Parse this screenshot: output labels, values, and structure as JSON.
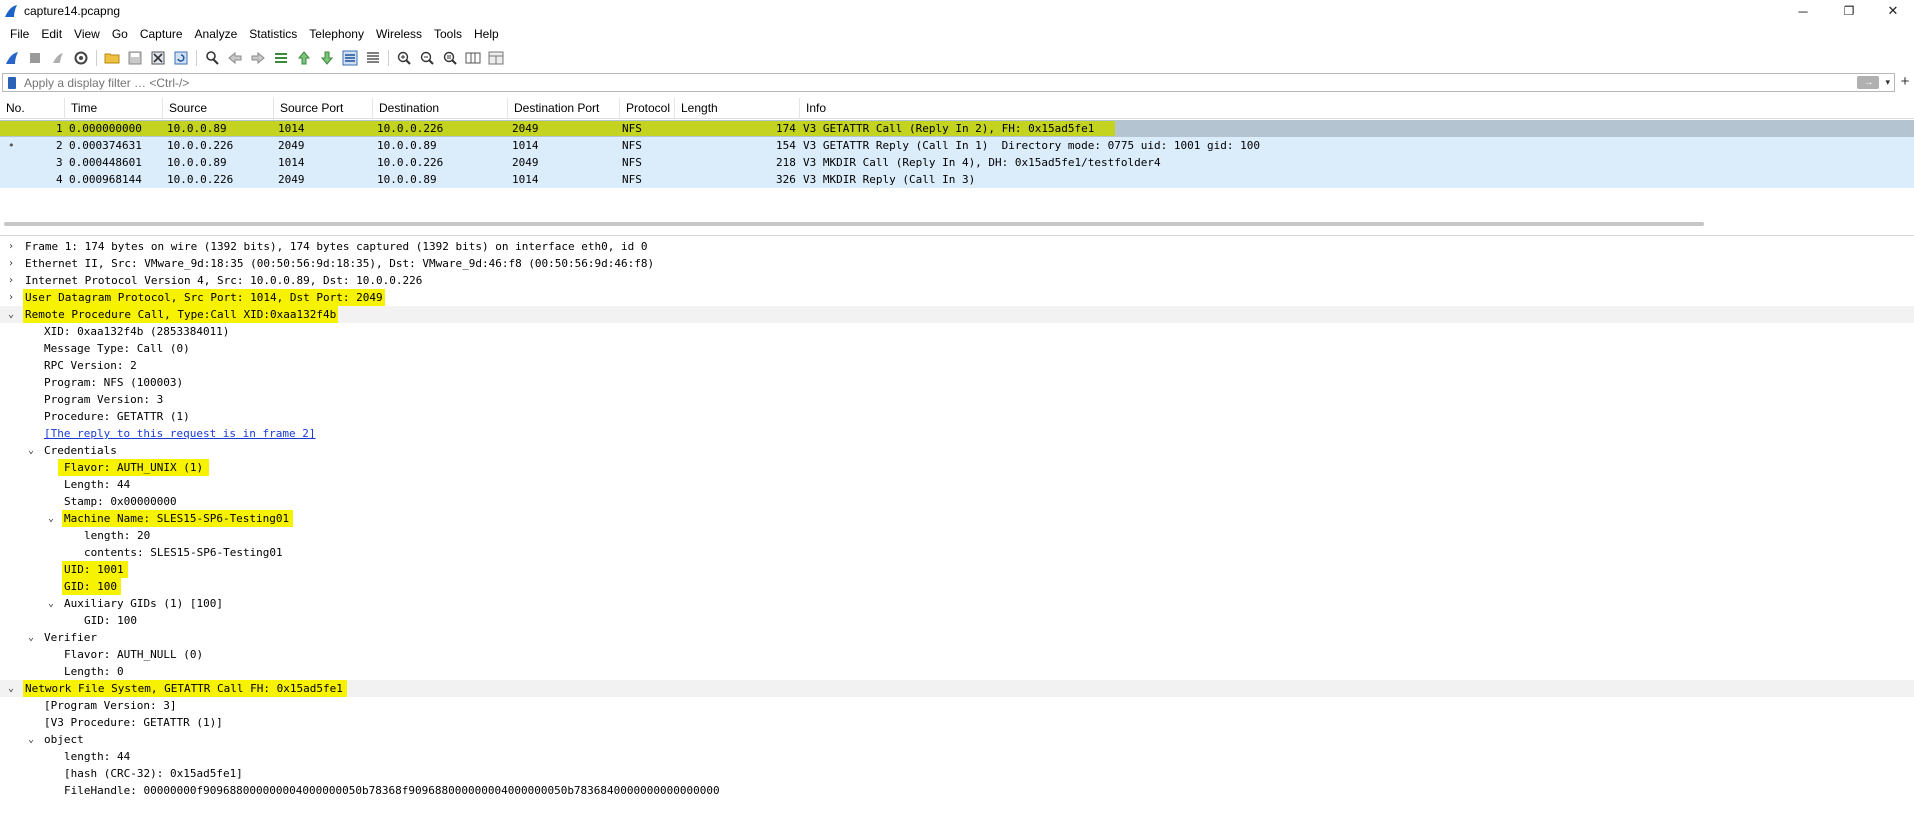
{
  "window": {
    "title": "capture14.pcapng",
    "minimize": "─",
    "maximize": "❐",
    "close": "✕"
  },
  "menu": [
    "File",
    "Edit",
    "View",
    "Go",
    "Capture",
    "Analyze",
    "Statistics",
    "Telephony",
    "Wireless",
    "Tools",
    "Help"
  ],
  "toolbar": [
    "start-capture-icon",
    "stop-capture-icon",
    "restart-capture-icon",
    "capture-options-icon",
    "open-file-icon",
    "save-file-icon",
    "close-file-icon",
    "reload-file-icon",
    "find-packet-icon",
    "go-back-icon",
    "go-forward-icon",
    "go-to-packet-icon",
    "first-packet-icon",
    "last-packet-icon",
    "autoscroll-icon",
    "colorize-icon",
    "zoom-in-icon",
    "zoom-out-icon",
    "normal-size-icon",
    "resize-columns-icon",
    "layout-icon"
  ],
  "filter": {
    "placeholder": "Apply a display filter … <Ctrl-/>",
    "plus": "+",
    "apply": "→",
    "dropdown": "▾"
  },
  "columns": [
    "No.",
    "Time",
    "Source",
    "Source Port",
    "Destination",
    "Destination Port",
    "Protocol",
    "Length",
    "Info"
  ],
  "packets": [
    {
      "marker": "",
      "no": "1",
      "time": "0.000000000",
      "src": "10.0.0.89",
      "sport": "1014",
      "dst": "10.0.0.226",
      "dport": "2049",
      "proto": "NFS",
      "len": "174",
      "info": "V3 GETATTR Call (Reply In 2), FH: 0x15ad5fe1"
    },
    {
      "marker": "•",
      "no": "2",
      "time": "0.000374631",
      "src": "10.0.0.226",
      "sport": "2049",
      "dst": "10.0.0.89",
      "dport": "1014",
      "proto": "NFS",
      "len": "154",
      "info": "V3 GETATTR Reply (Call In 1)  Directory mode: 0775 uid: 1001 gid: 100"
    },
    {
      "marker": "",
      "no": "3",
      "time": "0.000448601",
      "src": "10.0.0.89",
      "sport": "1014",
      "dst": "10.0.0.226",
      "dport": "2049",
      "proto": "NFS",
      "len": "218",
      "info": "V3 MKDIR Call (Reply In 4), DH: 0x15ad5fe1/testfolder4"
    },
    {
      "marker": "",
      "no": "4",
      "time": "0.000968144",
      "src": "10.0.0.226",
      "sport": "2049",
      "dst": "10.0.0.89",
      "dport": "1014",
      "proto": "NFS",
      "len": "326",
      "info": "V3 MKDIR Reply (Call In 3)"
    }
  ],
  "details": [
    {
      "arrow": "›",
      "text": "Frame 1: 174 bytes on wire (1392 bits), 174 bytes captured (1392 bits) on interface eth0, id 0"
    },
    {
      "arrow": "›",
      "text": "Ethernet II, Src: VMware_9d:18:35 (00:50:56:9d:18:35), Dst: VMware_9d:46:f8 (00:50:56:9d:46:f8)"
    },
    {
      "arrow": "›",
      "text": "Internet Protocol Version 4, Src: 10.0.0.89, Dst: 10.0.0.226"
    },
    {
      "arrow": "›",
      "text": "User Datagram Protocol, Src Port: 1014, Dst Port: 2049"
    },
    {
      "arrow": "⌄",
      "text": "Remote Procedure Call, Type:Call XID:0xaa132f4b"
    },
    {
      "arrow": "",
      "text": "XID: 0xaa132f4b (2853384011)"
    },
    {
      "arrow": "",
      "text": "Message Type: Call (0)"
    },
    {
      "arrow": "",
      "text": "RPC Version: 2"
    },
    {
      "arrow": "",
      "text": "Program: NFS (100003)"
    },
    {
      "arrow": "",
      "text": "Program Version: 3"
    },
    {
      "arrow": "",
      "text": "Procedure: GETATTR (1)"
    },
    {
      "arrow": "",
      "text": "[The reply to this request is in frame 2]"
    },
    {
      "arrow": "⌄",
      "text": "Credentials"
    },
    {
      "arrow": "",
      "text": "Flavor: AUTH_UNIX (1)"
    },
    {
      "arrow": "",
      "text": "Length: 44"
    },
    {
      "arrow": "",
      "text": "Stamp: 0x00000000"
    },
    {
      "arrow": "⌄",
      "text": "Machine Name: SLES15-SP6-Testing01"
    },
    {
      "arrow": "",
      "text": "length: 20"
    },
    {
      "arrow": "",
      "text": "contents: SLES15-SP6-Testing01"
    },
    {
      "arrow": "",
      "text": "UID: 1001"
    },
    {
      "arrow": "",
      "text": "GID: 100"
    },
    {
      "arrow": "⌄",
      "text": "Auxiliary GIDs (1) [100]"
    },
    {
      "arrow": "",
      "text": "GID: 100"
    },
    {
      "arrow": "⌄",
      "text": "Verifier"
    },
    {
      "arrow": "",
      "text": "Flavor: AUTH_NULL (0)"
    },
    {
      "arrow": "",
      "text": "Length: 0"
    },
    {
      "arrow": "⌄",
      "text": "Network File System, GETATTR Call FH: 0x15ad5fe1"
    },
    {
      "arrow": "",
      "text": "[Program Version: 3]"
    },
    {
      "arrow": "",
      "text": "[V3 Procedure: GETATTR (1)]"
    },
    {
      "arrow": "⌄",
      "text": "object"
    },
    {
      "arrow": "",
      "text": "length: 44"
    },
    {
      "arrow": "",
      "text": "[hash (CRC-32): 0x15ad5fe1]"
    },
    {
      "arrow": "",
      "text": "FileHandle: 00000000f909688000000004000000050b78368f909688000000004000000050b7836840000000000000000"
    }
  ],
  "colors": {
    "selected_row": "#b5c4d1",
    "nfs_row": "#dbecfb",
    "highlight": "#f7f300",
    "link": "#1a3bd1"
  }
}
